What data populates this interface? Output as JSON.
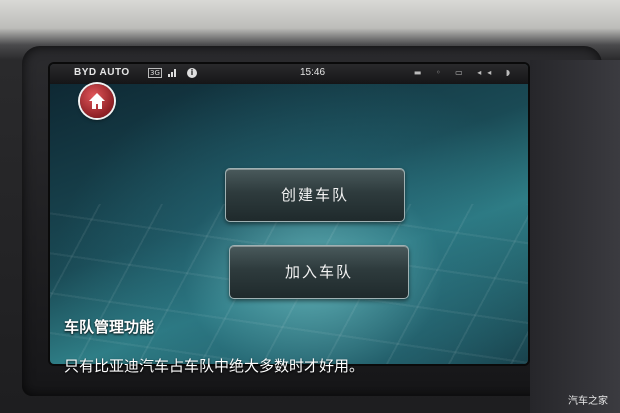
{
  "statusbar": {
    "brand": "BYD AUTO",
    "network": "3G",
    "signal_icon": "signal-bars-icon",
    "info_icon": "info-icon",
    "time": "15:46"
  },
  "home": {
    "icon": "home-icon"
  },
  "menu": {
    "create_team": "创建车队",
    "join_team": "加入车队"
  },
  "caption": {
    "title": "车队管理功能",
    "text": "只有比亚迪汽车占车队中绝大多数时才好用。"
  },
  "watermark": "汽车之家",
  "colors": {
    "home_button": "#c0393e",
    "screen_tint": "#2f7f87"
  }
}
